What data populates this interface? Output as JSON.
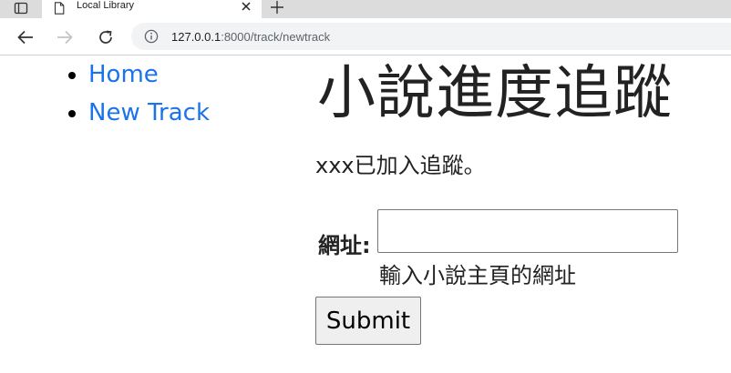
{
  "browser": {
    "tab": {
      "title": "Local Library"
    },
    "address_bar": {
      "host": "127.0.0.1",
      "path": ":8000/track/newtrack"
    }
  },
  "nav": {
    "items": [
      {
        "label": "Home"
      },
      {
        "label": "New Track"
      }
    ]
  },
  "main": {
    "title": "小說進度追蹤",
    "message": "xxx已加入追蹤。",
    "form": {
      "url_label": "網址:",
      "url_value": "",
      "url_help": "輸入小說主頁的網址",
      "submit_label": "Submit"
    }
  },
  "colors": {
    "link": "#1a73e8",
    "tab_strip": "#dcdcdc",
    "omnibox": "#f1f3f4"
  }
}
